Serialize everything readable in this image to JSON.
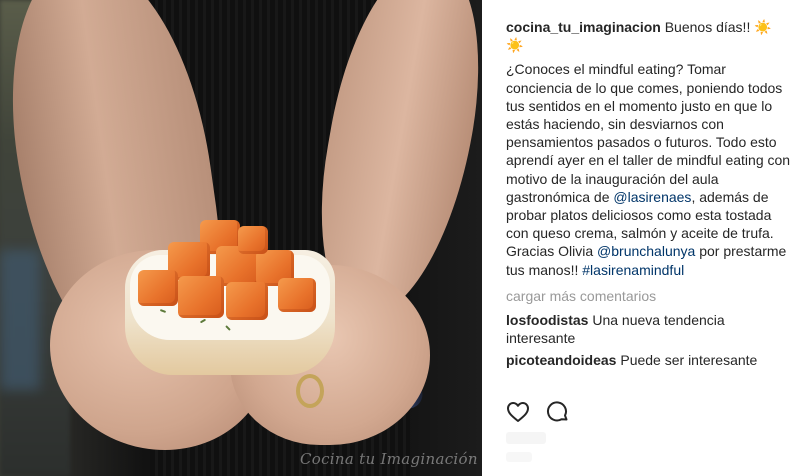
{
  "post": {
    "watermark": "Cocina tu Imaginación"
  },
  "caption": {
    "username": "cocina_tu_imaginacion",
    "intro": " Buenos días!! ☀️ ☀️",
    "text_1": "¿Conoces el mindful eating? Tomar conciencia de lo que comes, poniendo todos tus sentidos en el momento justo en que lo estás haciendo, sin desviarnos con pensamientos pasados o futuros. Todo esto aprendí ayer en el taller de mindful eating con motivo de la inauguración del aula gastronómica de ",
    "mention_1": "@lasirenaes",
    "text_2": ", además de probar platos deliciosos como esta tostada con queso crema, salmón y aceite de trufa. Gracias Olivia ",
    "mention_2": "@brunchalunya",
    "text_3": " por prestarme tus manos!! ",
    "hashtag": "#lasirenamindful"
  },
  "load_more_label": "cargar más comentarios",
  "comments": [
    {
      "username": "losfoodistas",
      "text": " Una nueva tendencia interesante"
    },
    {
      "username": "picoteandoideas",
      "text": " Puede ser interesante"
    }
  ],
  "icons": {
    "like": "heart-icon",
    "comment": "comment-icon"
  }
}
